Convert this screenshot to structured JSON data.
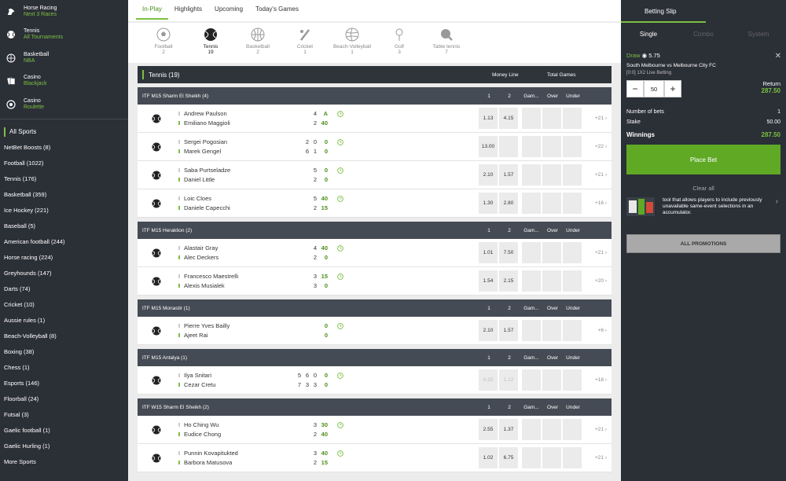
{
  "sidebar": {
    "quick_links": [
      {
        "title": "Horse Racing",
        "sub": "Next 3 Races",
        "icon": "horse-icon"
      },
      {
        "title": "Tennis",
        "sub": "All Tournaments",
        "icon": "tennis-ball-icon"
      },
      {
        "title": "Basketball",
        "sub": "NBA",
        "icon": "basketball-icon"
      },
      {
        "title": "Casino",
        "sub": "Blackjack",
        "icon": "cards-icon"
      },
      {
        "title": "Casino",
        "sub": "Roulette",
        "icon": "roulette-icon"
      }
    ],
    "all_sports_label": "All Sports",
    "items": [
      "NetBet Boosts (8)",
      "Football (1022)",
      "Tennis (176)",
      "Basketball (359)",
      "Ice Hockey (221)",
      "Baseball (5)",
      "American football (244)",
      "Horse racing (224)",
      "Greyhounds (147)",
      "Darts (74)",
      "Cricket (10)",
      "Aussie rules (1)",
      "Beach-Volleyball (8)",
      "Boxing (38)",
      "Chess (1)",
      "Esports (146)",
      "Floorball (24)",
      "Futsal (3)",
      "Gaelic football (1)",
      "Gaelic Hurling (1)",
      "More Sports"
    ]
  },
  "tabs": [
    "In-Play",
    "Highlights",
    "Upcoming",
    "Today's Games"
  ],
  "sports": [
    {
      "name": "Football",
      "count": "2"
    },
    {
      "name": "Tennis",
      "count": "19"
    },
    {
      "name": "Basketball",
      "count": "2"
    },
    {
      "name": "Cricket",
      "count": "1"
    },
    {
      "name": "Beach-Volleyball",
      "count": "1"
    },
    {
      "name": "Golf",
      "count": "3"
    },
    {
      "name": "Table tennis",
      "count": "7"
    }
  ],
  "section": {
    "title": "Tennis (19)",
    "col_money_line": "Money Line",
    "col_total_games": "Total Games"
  },
  "col_labels": {
    "one": "1",
    "two": "2",
    "games": "Gam...",
    "over": "Over",
    "under": "Under"
  },
  "leagues": [
    {
      "name": "ITF M15 Sharm El Sheikh (4)",
      "matches": [
        {
          "p1": "Andrew Paulson",
          "p2": "Emiliano Maggioli",
          "s1": [
            "4"
          ],
          "s2": [
            "2"
          ],
          "pt1": "A",
          "pt2": "40",
          "o1": "1.13",
          "o2": "4.15",
          "more": "+21"
        },
        {
          "p1": "Sergei Pogosian",
          "p2": "Marek Gengel",
          "s1": [
            "2",
            "0"
          ],
          "s2": [
            "6",
            "1"
          ],
          "pt1": "0",
          "pt2": "0",
          "o1": "13.00",
          "o2": "",
          "more": "+22"
        },
        {
          "p1": "Saba Purtseladze",
          "p2": "Daniel Little",
          "s1": [
            "5"
          ],
          "s2": [
            "2"
          ],
          "pt1": "0",
          "pt2": "0",
          "o1": "2.10",
          "o2": "1.57",
          "more": "+21"
        },
        {
          "p1": "Loic Cloes",
          "p2": "Daniele Capecchi",
          "s1": [
            "5"
          ],
          "s2": [
            "2"
          ],
          "pt1": "40",
          "pt2": "15",
          "o1": "1.30",
          "o2": "2.80",
          "more": "+16"
        }
      ]
    },
    {
      "name": "ITF M15 Heraklion (2)",
      "matches": [
        {
          "p1": "Alastair Gray",
          "p2": "Alec Deckers",
          "s1": [
            "4"
          ],
          "s2": [
            "2"
          ],
          "pt1": "40",
          "pt2": "0",
          "o1": "1.01",
          "o2": "7.50",
          "more": "+21"
        },
        {
          "p1": "Francesco Maestrelli",
          "p2": "Alexis Musialek",
          "s1": [
            "3"
          ],
          "s2": [
            "3"
          ],
          "pt1": "15",
          "pt2": "0",
          "o1": "1.54",
          "o2": "2.15",
          "more": "+20"
        }
      ]
    },
    {
      "name": "ITF M15 Monastir (1)",
      "matches": [
        {
          "p1": "Pierre Yves Bailly",
          "p2": "Ajeet Rai",
          "s1": [],
          "s2": [],
          "pt1": "0",
          "pt2": "0",
          "o1": "2.10",
          "o2": "1.57",
          "more": "+6"
        }
      ]
    },
    {
      "name": "ITF M15 Antalya (1)",
      "matches": [
        {
          "p1": "Ilya Snitari",
          "p2": "Cezar Cretu",
          "s1": [
            "5",
            "6",
            "0"
          ],
          "s2": [
            "7",
            "3",
            "3"
          ],
          "pt1": "0",
          "pt2": "0",
          "o1": "4.25",
          "o2": "1.12",
          "more": "+18",
          "faded": true
        }
      ]
    },
    {
      "name": "ITF W15 Sharm El Sheikh (2)",
      "matches": [
        {
          "p1": "Ho Ching Wu",
          "p2": "Eudice Chong",
          "s1": [
            "3"
          ],
          "s2": [
            "2"
          ],
          "pt1": "30",
          "pt2": "40",
          "o1": "2.55",
          "o2": "1.37",
          "more": "+21"
        },
        {
          "p1": "Punnin Kovapitukted",
          "p2": "Barbora Matusova",
          "s1": [
            "3"
          ],
          "s2": [
            "2"
          ],
          "pt1": "40",
          "pt2": "15",
          "o1": "1.02",
          "o2": "6.75",
          "more": "+21"
        }
      ]
    }
  ],
  "slip": {
    "title": "Betting Slip",
    "tabs": [
      "Single",
      "Combo",
      "System"
    ],
    "selection_label": "Draw",
    "selection_odds": "5.75",
    "event": "South Melbourne vs Melbourne City FC",
    "market": "[0:0] 1X2 Live Betting",
    "stake": "50",
    "return_label": "Return",
    "return_value": "287.50",
    "num_bets_label": "Number of bets",
    "num_bets_value": "1",
    "stake_label": "Stake",
    "stake_value": "50.00",
    "winnings_label": "Winnings",
    "winnings_value": "287.50",
    "place_bet": "Place Bet",
    "clear_all": "Clear all",
    "promo_text": "tool that allows players to include previously unavailable same-event selections in an accumulator.",
    "all_promotions": "ALL PROMOTIONS"
  },
  "colors": {
    "accent": "#7bc043",
    "dark": "#2b2f36",
    "header": "#454b54"
  }
}
